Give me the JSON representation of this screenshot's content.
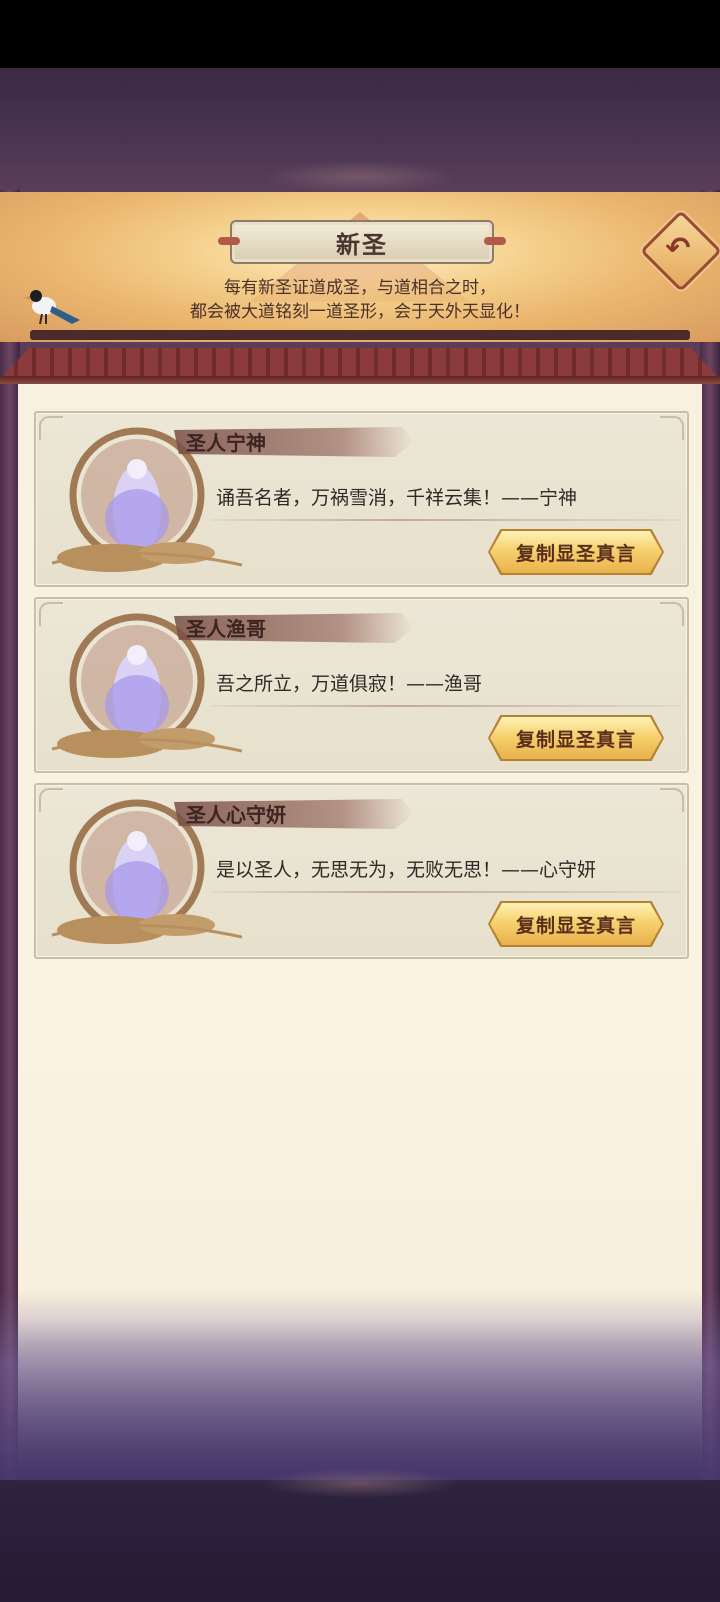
{
  "header": {
    "title": "新圣",
    "subtitle_line1": "每有新圣证道成圣，与道相合之时，",
    "subtitle_line2": "都会被大道铭刻一道圣形，会于天外天显化！",
    "back_icon": "return-arrow-icon"
  },
  "saints": [
    {
      "name": "圣人宁神",
      "quote": "诵吾名者，万祸雪消，千祥云集！——宁神",
      "button_label": "复制显圣真言"
    },
    {
      "name": "圣人渔哥",
      "quote": "吾之所立，万道俱寂！——渔哥",
      "button_label": "复制显圣真言"
    },
    {
      "name": "圣人心守妍",
      "quote": "是以圣人，无思无为，无败无思！——心守妍",
      "button_label": "复制显圣真言"
    }
  ],
  "colors": {
    "paper": "#faf3e2",
    "card": "#e9e3d0",
    "button_gold": "#f6d16e",
    "accent_red": "#8b3b3b"
  }
}
